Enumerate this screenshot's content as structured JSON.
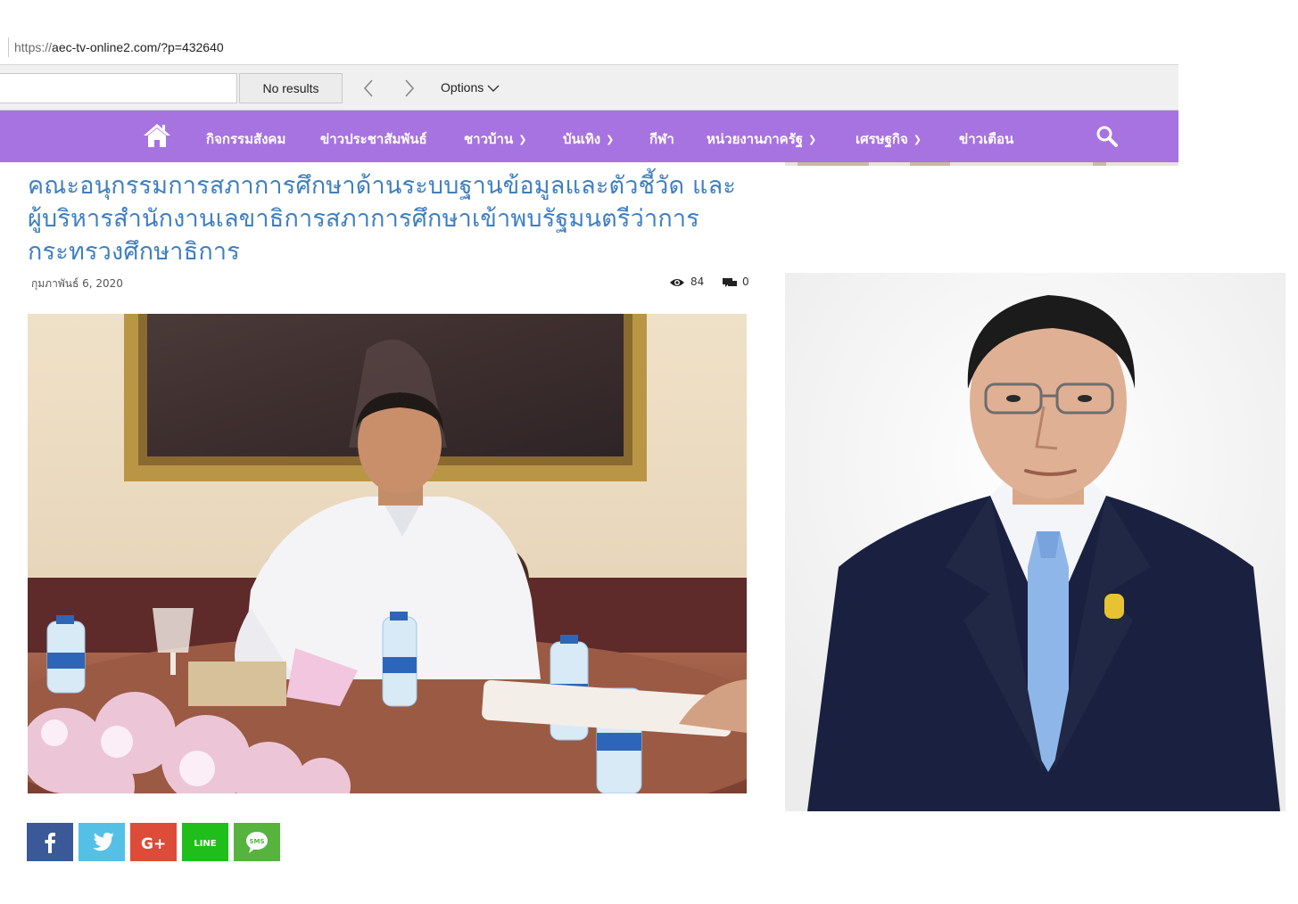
{
  "browser": {
    "url_prefix": "https://",
    "url_main": "aec-tv-online2.com/?p=432640"
  },
  "find_bar": {
    "input_value": "",
    "result_text": "No results",
    "options_label": "Options"
  },
  "nav": {
    "items": [
      {
        "label": "กิจกรรมสังคม",
        "has_dropdown": false
      },
      {
        "label": "ข่าวประชาสัมพันธ์",
        "has_dropdown": false
      },
      {
        "label": "ชาวบ้าน",
        "has_dropdown": true
      },
      {
        "label": "บันเทิง",
        "has_dropdown": true
      },
      {
        "label": "กีฬา",
        "has_dropdown": false
      },
      {
        "label": "หน่วยงานภาครัฐ",
        "has_dropdown": true
      },
      {
        "label": "เศรษฐกิจ",
        "has_dropdown": true
      },
      {
        "label": "ข่าวเตือน",
        "has_dropdown": false
      }
    ],
    "background_color": "#a773e0"
  },
  "article": {
    "title_line1": "คณะอนุกรรมการสภาการศึกษาด้านระบบฐานข้อมูลและตัวชี้วัด และ",
    "title_line2": "ผู้บริหารสำนักงานเลขาธิการสภาการศึกษาเข้าพบรัฐมนตรีว่าการ",
    "title_line3": "กระทรวงศึกษาธิการ",
    "date": "กุมภาพันธ์ 6, 2020",
    "views": "84",
    "comments": "0",
    "title_color": "#3f7fc0"
  },
  "share": {
    "buttons": [
      {
        "name": "facebook",
        "color": "#3b5998"
      },
      {
        "name": "twitter",
        "color": "#55c0e6"
      },
      {
        "name": "google-plus",
        "color": "#dd4b39"
      },
      {
        "name": "line",
        "label": "LINE",
        "color": "#1fbe1b"
      },
      {
        "name": "sms",
        "label": "SMS",
        "color": "#55b33e"
      }
    ]
  }
}
